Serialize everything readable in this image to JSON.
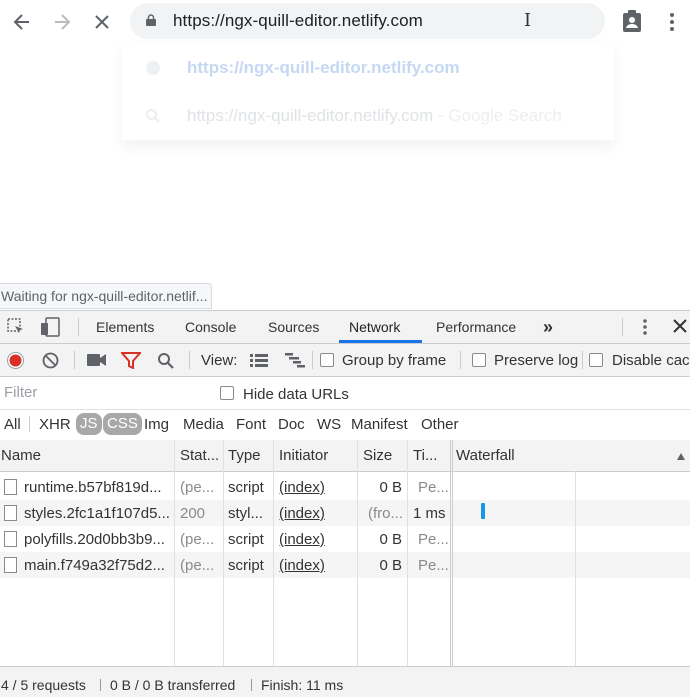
{
  "browser": {
    "url": "https://ngx-quill-editor.netlify.com",
    "suggestions": [
      {
        "text": "https://ngx-quill-editor.netlify.com",
        "suffix": ""
      },
      {
        "text": "https://ngx-quill-editor.netlify.com",
        "suffix": " - Google Search"
      }
    ],
    "status_text": "Waiting for ngx-quill-editor.netlif..."
  },
  "devtools": {
    "tabs": [
      "Elements",
      "Console",
      "Sources",
      "Network",
      "Performance"
    ],
    "active_tab": "Network",
    "more_tabs_label": "»",
    "toolbar": {
      "view_label": "View:",
      "group_by_frame": "Group by frame",
      "preserve_log": "Preserve log",
      "disable_cache": "Disable cach"
    },
    "filter": {
      "placeholder": "Filter",
      "hide_data_urls": "Hide data URLs"
    },
    "types": [
      "All",
      "XHR",
      "JS",
      "CSS",
      "Img",
      "Media",
      "Font",
      "Doc",
      "WS",
      "Manifest",
      "Other"
    ],
    "selected_types": [
      "JS",
      "CSS"
    ],
    "columns": [
      "Name",
      "Stat...",
      "Type",
      "Initiator",
      "Size",
      "Ti...",
      "Waterfall"
    ],
    "rows": [
      {
        "name": "runtime.b57bf819d...",
        "status": "(pe...",
        "type": "script",
        "initiator": "(index)",
        "size": "0 B",
        "time": "Pe..."
      },
      {
        "name": "styles.2fc1a1f107d5...",
        "status": "200",
        "type": "styl...",
        "initiator": "(index)",
        "size": "(fro...",
        "time": "1 ms"
      },
      {
        "name": "polyfills.20d0bb3b9...",
        "status": "(pe...",
        "type": "script",
        "initiator": "(index)",
        "size": "0 B",
        "time": "Pe..."
      },
      {
        "name": "main.f749a32f75d2...",
        "status": "(pe...",
        "type": "script",
        "initiator": "(index)",
        "size": "0 B",
        "time": "Pe..."
      }
    ],
    "summary": {
      "requests": "4 / 5 requests",
      "transferred": "0 B / 0 B transferred",
      "finish": "Finish: 11 ms"
    },
    "colors": {
      "accent": "#1a73e8",
      "record": "#d93025",
      "filter_active": "#d93025",
      "waterfall_bar": "#1a98e8"
    }
  }
}
